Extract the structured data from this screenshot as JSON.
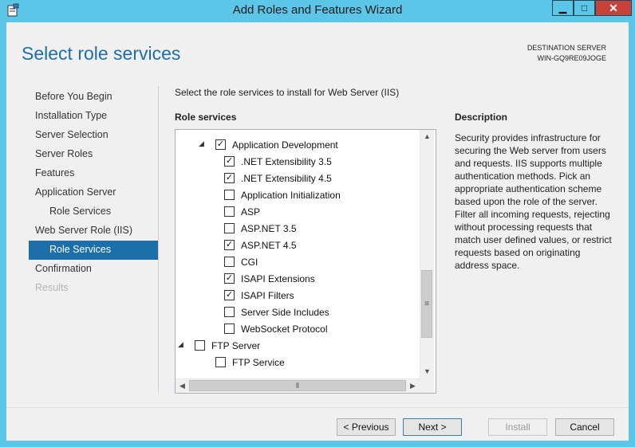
{
  "window": {
    "title": "Add Roles and Features Wizard",
    "controls": {
      "minimize": "▁",
      "maximize": "□",
      "close": "✕"
    }
  },
  "header": {
    "page_title": "Select role services",
    "destination_label": "DESTINATION SERVER",
    "destination_server": "WIN-GQ9RE09JOGE"
  },
  "nav": {
    "items": [
      {
        "label": "Before You Begin",
        "level": 0,
        "state": "normal"
      },
      {
        "label": "Installation Type",
        "level": 0,
        "state": "normal"
      },
      {
        "label": "Server Selection",
        "level": 0,
        "state": "normal"
      },
      {
        "label": "Server Roles",
        "level": 0,
        "state": "normal"
      },
      {
        "label": "Features",
        "level": 0,
        "state": "normal"
      },
      {
        "label": "Application Server",
        "level": 0,
        "state": "normal"
      },
      {
        "label": "Role Services",
        "level": 1,
        "state": "normal"
      },
      {
        "label": "Web Server Role (IIS)",
        "level": 0,
        "state": "normal"
      },
      {
        "label": "Role Services",
        "level": 1,
        "state": "active"
      },
      {
        "label": "Confirmation",
        "level": 0,
        "state": "normal"
      },
      {
        "label": "Results",
        "level": 0,
        "state": "disabled"
      }
    ]
  },
  "main": {
    "instruction": "Select the role services to install for Web Server (IIS)",
    "role_services_header": "Role services",
    "tree": [
      {
        "label": "Application Development",
        "checked": true,
        "expander": "◢",
        "indent": 1
      },
      {
        "label": ".NET Extensibility 3.5",
        "checked": true,
        "indent": 2
      },
      {
        "label": ".NET Extensibility 4.5",
        "checked": true,
        "indent": 2
      },
      {
        "label": "Application Initialization",
        "checked": false,
        "indent": 2
      },
      {
        "label": "ASP",
        "checked": false,
        "indent": 2
      },
      {
        "label": "ASP.NET 3.5",
        "checked": false,
        "indent": 2
      },
      {
        "label": "ASP.NET 4.5",
        "checked": true,
        "indent": 2
      },
      {
        "label": "CGI",
        "checked": false,
        "indent": 2
      },
      {
        "label": "ISAPI Extensions",
        "checked": true,
        "indent": 2
      },
      {
        "label": "ISAPI Filters",
        "checked": true,
        "indent": 2
      },
      {
        "label": "Server Side Includes",
        "checked": false,
        "indent": 2
      },
      {
        "label": "WebSocket Protocol",
        "checked": false,
        "indent": 2
      },
      {
        "label": "FTP Server",
        "checked": false,
        "expander": "◢",
        "indent": 0
      },
      {
        "label": "FTP Service",
        "checked": false,
        "indent": 1
      }
    ],
    "description_header": "Description",
    "description_text": "Security provides infrastructure for securing the Web server from users and requests. IIS supports multiple authentication methods. Pick an appropriate authentication scheme based upon the role of the server. Filter all incoming requests, rejecting without processing requests that match user defined values, or restrict requests based on originating address space."
  },
  "footer": {
    "previous": "< Previous",
    "next": "Next >",
    "install": "Install",
    "cancel": "Cancel"
  },
  "colors": {
    "accent": "#1c6fa8",
    "titlebar": "#5bc6e8",
    "close": "#c7423a"
  }
}
